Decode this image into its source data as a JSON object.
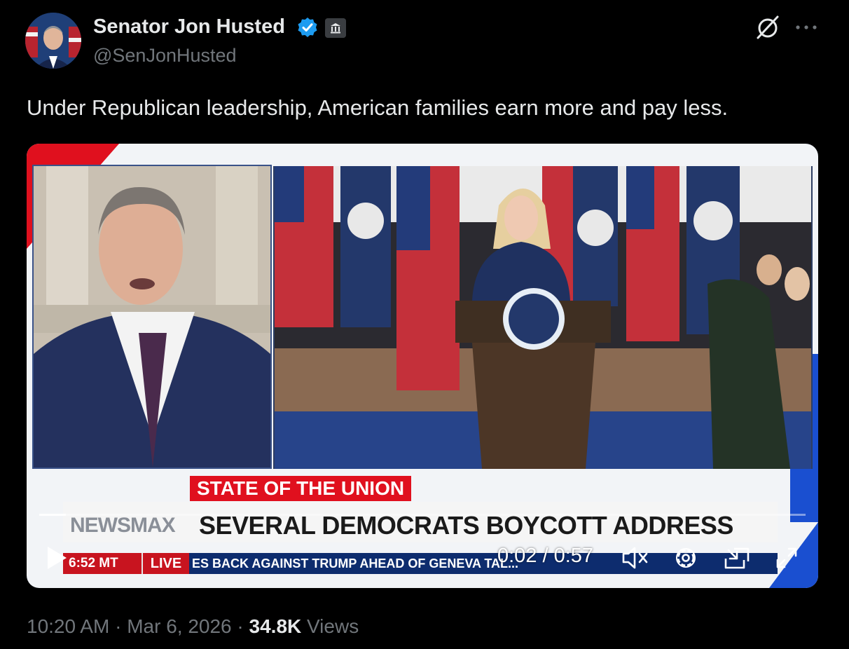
{
  "author": {
    "name": "Senator Jon Husted",
    "handle": "@SenJonHusted"
  },
  "icons": {
    "avatar": "avatar-photo",
    "verified": "verified-badge-icon",
    "gov_badge": "government-building-icon",
    "grok": "grok-icon",
    "more": "more-icon"
  },
  "tweet": {
    "text": "Under Republican leadership, American families earn more and pay less."
  },
  "video": {
    "tag": "STATE OF THE UNION",
    "channel": "NEWSMAX",
    "headline": "SEVERAL DEMOCRATS BOYCOTT ADDRESS",
    "clock": "6:52 MT",
    "live_label": "LIVE",
    "ticker": "ES BACK AGAINST TRUMP AHEAD OF GENEVA TAL...",
    "time": "0:02 / 0:57",
    "progress_fraction": 0.035
  },
  "meta": {
    "time": "10:20 AM",
    "sep1": " · ",
    "date": "Mar 6, 2026",
    "sep2": " · ",
    "views_count": "34.8K",
    "views_label": " Views"
  },
  "colors": {
    "background": "#000000",
    "text": "#e7e9ea",
    "secondary": "#71767b",
    "verified": "#1d9bf0",
    "accent_red": "#e0101e"
  }
}
